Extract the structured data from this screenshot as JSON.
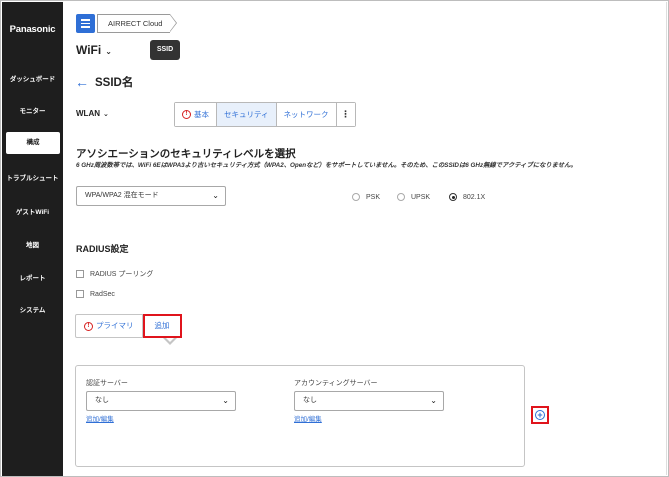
{
  "sidebar": {
    "brand": "Panasonic",
    "items": [
      {
        "label": "ダッシュボード"
      },
      {
        "label": "モニター"
      },
      {
        "label": "構成"
      },
      {
        "label": "トラブルシュート"
      },
      {
        "label": "ゲストWiFi"
      },
      {
        "label": "地図"
      },
      {
        "label": "レポート"
      },
      {
        "label": "システム"
      }
    ],
    "active_index": 2
  },
  "breadcrumb": {
    "label": "AIRRECT Cloud"
  },
  "header": {
    "title": "WiFi",
    "ssid_button": "SSID"
  },
  "page": {
    "title": "SSID名"
  },
  "wlan": {
    "label": "WLAN"
  },
  "tabs": [
    {
      "label": "基本"
    },
    {
      "label": "セキュリティ"
    },
    {
      "label": "ネットワーク"
    },
    {
      "label": "⋮"
    }
  ],
  "security": {
    "title": "アソシエーションのセキュリティレベルを選択",
    "note": "6 GHz周波数帯では、WiFi 6EはWPA3より古いセキュリティ方式（WPA2、Openなど）をサポートしていません。そのため、このSSIDは6 GHz無線でアクティブになりません。",
    "mode_select": "WPA/WPA2 混在モード",
    "radios": [
      {
        "label": "PSK",
        "selected": false
      },
      {
        "label": "UPSK",
        "selected": false
      },
      {
        "label": "802.1X",
        "selected": true
      }
    ]
  },
  "radius": {
    "title": "RADIUS設定",
    "checks": [
      {
        "label": "RADIUS プーリング",
        "checked": false
      },
      {
        "label": "RadSec",
        "checked": false
      }
    ],
    "tabs": [
      {
        "label": "プライマリ"
      },
      {
        "label": "追加"
      }
    ],
    "auth_server": {
      "label": "認証サーバー",
      "value": "なし",
      "edit": "追加/編集"
    },
    "acct_server": {
      "label": "アカウンティングサーバー",
      "value": "なし",
      "edit": "追加/編集"
    }
  },
  "colors": {
    "accent": "#2f6fd6",
    "highlight": "#e0141c",
    "sidebar": "#1e1e1e"
  },
  "icons": [
    "hamburger-icon",
    "chevron-down-icon",
    "back-arrow-icon",
    "warning-icon",
    "more-vert-icon",
    "plus-circle-icon"
  ]
}
